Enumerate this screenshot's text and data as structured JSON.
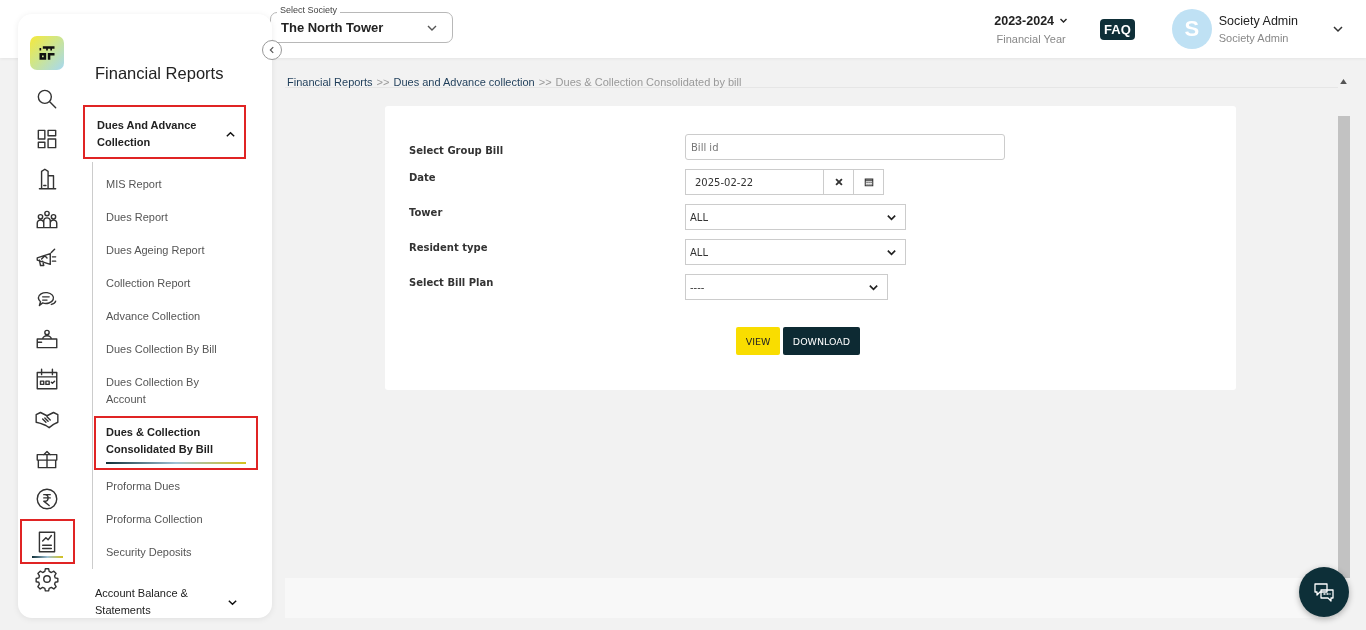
{
  "header": {
    "society_select": {
      "label": "Select Society",
      "value": "The North Tower"
    },
    "financial_year": {
      "value": "2023-2024",
      "caption": "Financial Year"
    },
    "faq": "FAQ",
    "user": {
      "initial": "S",
      "name": "Society Admin",
      "role": "Society Admin"
    }
  },
  "rail": [
    {
      "selected": false
    },
    {
      "selected": false
    },
    {
      "selected": false
    },
    {
      "selected": false
    },
    {
      "selected": false
    },
    {
      "selected": false
    },
    {
      "selected": false
    },
    {
      "selected": false
    },
    {
      "selected": false
    },
    {
      "selected": false
    },
    {
      "selected": false
    },
    {
      "selected": true
    },
    {
      "selected": false
    }
  ],
  "sidebar": {
    "title": "Financial Reports",
    "groups": [
      {
        "label": "Dues And Advance Collection",
        "expanded": true,
        "items": [
          {
            "label": "MIS Report",
            "selected": false
          },
          {
            "label": "Dues Report",
            "selected": false
          },
          {
            "label": "Dues Ageing Report",
            "selected": false
          },
          {
            "label": "Collection Report",
            "selected": false
          },
          {
            "label": "Advance Collection",
            "selected": false
          },
          {
            "label": "Dues Collection By Bill",
            "selected": false
          },
          {
            "label": "Dues Collection By Account",
            "selected": false
          },
          {
            "label": "Dues & Collection Consolidated By Bill",
            "selected": true
          },
          {
            "label": "Proforma Dues",
            "selected": false
          },
          {
            "label": "Proforma Collection",
            "selected": false
          },
          {
            "label": "Security Deposits",
            "selected": false
          }
        ]
      },
      {
        "label": "Account Balance & Statements",
        "expanded": false
      }
    ]
  },
  "breadcrumb": [
    {
      "label": "Financial Reports",
      "current": false,
      "separator": ">>"
    },
    {
      "label": "Dues and Advance collection",
      "current": false,
      "separator": ">>"
    },
    {
      "label": "Dues & Collection Consolidated by bill",
      "current": true
    }
  ],
  "form": {
    "fields": [
      {
        "kind": "text",
        "label": "Select Group Bill",
        "placeholder": "Bill id"
      },
      {
        "kind": "date",
        "label": "Date",
        "value": "2025-02-22"
      },
      {
        "kind": "select",
        "label": "Tower",
        "value": "ALL"
      },
      {
        "kind": "select",
        "label": "Resident type",
        "value": "ALL"
      },
      {
        "kind": "select",
        "label": "Select Bill Plan",
        "value": "----"
      }
    ],
    "buttons": [
      {
        "label": "VIEW",
        "kind": "primary"
      },
      {
        "label": "DOWNLOAD",
        "kind": "dark"
      }
    ]
  }
}
